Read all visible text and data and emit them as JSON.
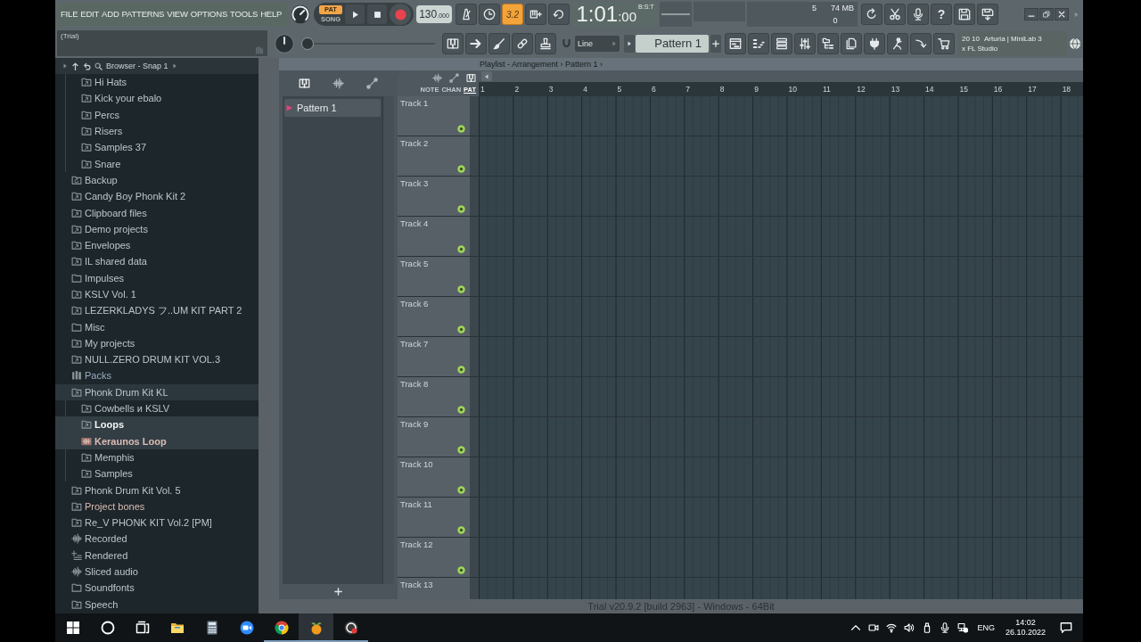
{
  "menu": [
    "FILE",
    "EDIT",
    "ADD",
    "PATTERNS",
    "VIEW",
    "OPTIONS",
    "TOOLS",
    "HELP"
  ],
  "hint_bar": {
    "text": "(Trial)"
  },
  "transport": {
    "modes": [
      {
        "label": "PAT",
        "selected": true
      },
      {
        "label": "SONG",
        "selected": false
      }
    ]
  },
  "tempo": {
    "whole": "130",
    "fraction": ".000"
  },
  "countdown": {
    "label": "3.2",
    "on": true
  },
  "time": {
    "main": "1:01",
    "ticks": ":00",
    "unit": "B:S:T"
  },
  "monitor": {
    "top_value": "5",
    "memory": "74 MB",
    "bottom_value": "0"
  },
  "help": {
    "label": "?"
  },
  "position_slider": {
    "level": 0
  },
  "snap": {
    "value": "Line"
  },
  "pattern_selector": {
    "value": "Pattern 1"
  },
  "news": {
    "date": "20 10",
    "lines": [
      "Arturia | MiniLab 3",
      "x FL Studio"
    ]
  },
  "browser": {
    "title": "Browser - Snap 1",
    "items": [
      {
        "children": [
          {
            "label": "Hi Hats",
            "kind": "folder",
            "selected": false
          },
          {
            "label": "Kick your ebalo",
            "kind": "folder",
            "selected": false
          },
          {
            "label": "Percs",
            "kind": "folder",
            "selected": false
          },
          {
            "label": "Risers",
            "kind": "folder",
            "selected": false
          },
          {
            "label": "Samples 37",
            "kind": "folder",
            "selected": false
          },
          {
            "label": "Snare",
            "kind": "folder",
            "selected": false
          }
        ]
      },
      {
        "label": "Backup",
        "kind": "backup",
        "selected": false
      },
      {
        "label": "Candy Boy Phonk Kit 2",
        "kind": "folder",
        "selected": false
      },
      {
        "label": "Clipboard files",
        "kind": "folder",
        "selected": false
      },
      {
        "label": "Demo projects",
        "kind": "folder",
        "selected": false
      },
      {
        "label": "Envelopes",
        "kind": "folder",
        "selected": false
      },
      {
        "label": "IL shared data",
        "kind": "folder",
        "selected": false
      },
      {
        "label": "Impulses",
        "kind": "plain",
        "selected": false
      },
      {
        "label": "KSLV Vol. 1",
        "kind": "folder",
        "selected": false
      },
      {
        "label": "LEZERKLADYS フ..UM KIT PART 2",
        "kind": "folder",
        "selected": false
      },
      {
        "label": "Misc",
        "kind": "plain",
        "selected": false
      },
      {
        "label": "My projects",
        "kind": "folder",
        "selected": false
      },
      {
        "label": "NULL.ZERO DRUM KIT VOL.3",
        "kind": "folder",
        "selected": false
      },
      {
        "label": "Packs",
        "kind": "packs",
        "selected": false
      },
      {
        "label": "Phonk Drum Kit KL",
        "kind": "folder",
        "selected": false,
        "expanded": true,
        "children": [
          {
            "label": "Cowbells и KSLV",
            "kind": "folder",
            "selected": false
          },
          {
            "label": "Loops",
            "kind": "folder",
            "selected": true
          },
          {
            "label": "Keraunos Loop",
            "kind": "sample",
            "selected": true
          },
          {
            "label": "Memphis",
            "kind": "folder",
            "selected": false
          },
          {
            "label": "Samples",
            "kind": "folder",
            "selected": false
          }
        ]
      },
      {
        "label": "Phonk Drum Kit Vol. 5",
        "kind": "folder",
        "selected": false
      },
      {
        "label": "Project bones",
        "kind": "project",
        "selected": false
      },
      {
        "label": "Re_V PHONK KIT Vol.2 [PM]",
        "kind": "folder",
        "selected": false
      },
      {
        "label": "Recorded",
        "kind": "audio",
        "selected": false
      },
      {
        "label": "Rendered",
        "kind": "rendered",
        "selected": false
      },
      {
        "label": "Sliced audio",
        "kind": "audio",
        "selected": false
      },
      {
        "label": "Soundfonts",
        "kind": "plain",
        "selected": false
      },
      {
        "label": "Speech",
        "kind": "folder",
        "selected": false
      }
    ]
  },
  "playlist": {
    "title": "Playlist - Arrangement › Pattern 1 ›",
    "patterns": [
      {
        "label": "Pattern 1",
        "selected": true
      }
    ],
    "filters": [
      {
        "label": "NOTE",
        "selected": false
      },
      {
        "label": "CHAN",
        "selected": false
      },
      {
        "label": "PAT",
        "selected": true
      }
    ],
    "ruler": [
      "1",
      "2",
      "3",
      "4",
      "5",
      "6",
      "7",
      "8",
      "9",
      "10",
      "11",
      "12",
      "13",
      "14",
      "15",
      "16",
      "17",
      "18"
    ],
    "tracks": [
      {
        "label": "Track 1",
        "on": true
      },
      {
        "label": "Track 2",
        "on": true
      },
      {
        "label": "Track 3",
        "on": true
      },
      {
        "label": "Track 4",
        "on": true
      },
      {
        "label": "Track 5",
        "on": true
      },
      {
        "label": "Track 6",
        "on": true
      },
      {
        "label": "Track 7",
        "on": true
      },
      {
        "label": "Track 8",
        "on": true
      },
      {
        "label": "Track 9",
        "on": true
      },
      {
        "label": "Track 10",
        "on": true
      },
      {
        "label": "Track 11",
        "on": true
      },
      {
        "label": "Track 12",
        "on": true
      },
      {
        "label": "Track 13"
      }
    ]
  },
  "version_text": "Trial v20.9.2 [build 2963] - Windows - 64Bit",
  "taskbar": {
    "apps": [
      {
        "kind": "start",
        "selected": false,
        "running": false
      },
      {
        "kind": "search",
        "selected": false,
        "running": false
      },
      {
        "kind": "taskview",
        "selected": false,
        "running": false
      },
      {
        "kind": "explorer",
        "selected": false,
        "running": false
      },
      {
        "kind": "calculator",
        "selected": false,
        "running": false
      },
      {
        "kind": "meeting",
        "selected": false,
        "running": false
      },
      {
        "kind": "browser",
        "selected": false,
        "running": true
      },
      {
        "kind": "daw",
        "selected": true,
        "running": true
      },
      {
        "kind": "recorder",
        "selected": false,
        "running": true
      }
    ],
    "language": "ENG",
    "time": "14:02",
    "date": "26.10.2022"
  }
}
